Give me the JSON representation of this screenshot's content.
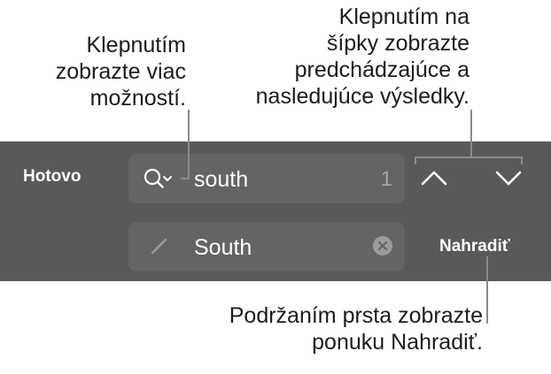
{
  "callouts": {
    "options": [
      "Klepnutím",
      "zobrazte viac",
      "možností."
    ],
    "arrows": [
      "Klepnutím na",
      "šípky zobrazte",
      "predchádzajúce a",
      "nasledujúce výsledky."
    ],
    "replace": [
      "Podržaním prsta zobrazte",
      "ponuku Nahradiť."
    ]
  },
  "toolbar": {
    "done_label": "Hotovo",
    "replace_label": "Nahradiť"
  },
  "search": {
    "value": "south",
    "match_count": "1",
    "icon": "search-options-icon"
  },
  "replace": {
    "value": "South",
    "icon": "pencil-icon",
    "clear_icon": "clear-icon"
  },
  "navigation": {
    "previous_icon": "chevron-up-icon",
    "next_icon": "chevron-down-icon"
  },
  "colors": {
    "toolbar_bg": "#595959",
    "field_bg": "#646464",
    "text": "#ffffff",
    "leader": "#8a8a8a"
  }
}
